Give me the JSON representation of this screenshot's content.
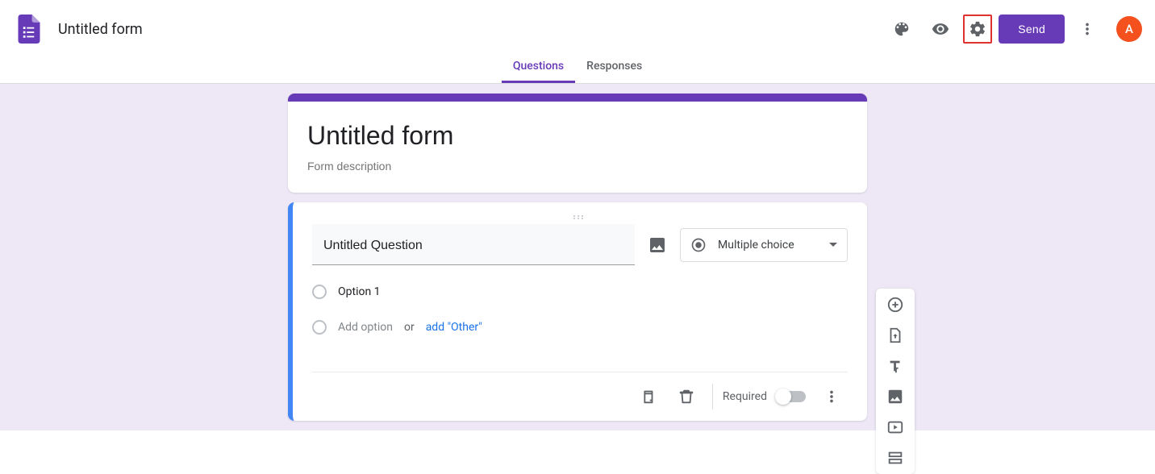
{
  "header": {
    "doc_title": "Untitled form",
    "send_label": "Send",
    "avatar_initial": "A"
  },
  "tabs": {
    "questions": "Questions",
    "responses": "Responses"
  },
  "form": {
    "title": "Untitled form",
    "description_placeholder": "Form description"
  },
  "question": {
    "title": "Untitled Question",
    "type_label": "Multiple choice",
    "option1": "Option 1",
    "add_option": "Add option",
    "or": "or",
    "add_other": "add \"Other\"",
    "required_label": "Required"
  }
}
